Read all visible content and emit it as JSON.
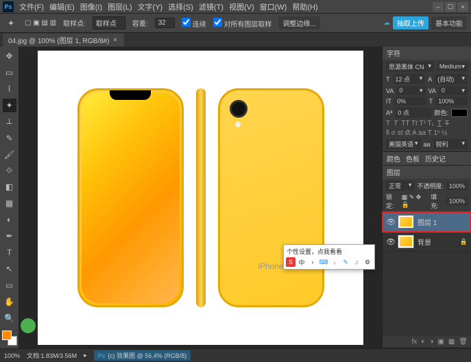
{
  "menu": [
    "文件(F)",
    "编辑(E)",
    "图像(I)",
    "图层(L)",
    "文字(Y)",
    "选择(S)",
    "滤镜(T)",
    "视图(V)",
    "窗口(W)",
    "帮助(H)"
  ],
  "options": {
    "sample_label": "取样点:",
    "sample_val": "取样点",
    "diameter_label": "容差:",
    "diameter_val": "32",
    "anti": "连续",
    "contig": "对所有图层取样",
    "refine": "调整边缘...",
    "upload": "抽取上传",
    "essentials": "基本功能"
  },
  "doc_tab": "04.jpg @ 100% (图层 1, RGB/8#)",
  "char_panel": {
    "tab": "字符",
    "font": "思源黑体 CN",
    "weight": "Medium",
    "size_label": "T",
    "size": "12 点",
    "leading_label": "A",
    "leading": "(自动)",
    "va": "VA",
    "va_val": "0",
    "tracking": "0",
    "scale_h": "0%",
    "scale_v": "",
    "baseline": "0 点",
    "color_label": "颜色:",
    "text_pct": "100%",
    "lang": "美国英语",
    "aa": "锐利"
  },
  "history_tabs": [
    "颜色",
    "色板",
    "历史记"
  ],
  "layers": {
    "tab": "图层",
    "blend": "正常",
    "opacity_label": "不透明度:",
    "opacity": "100%",
    "lock_label": "锁定:",
    "fill_label": "填充:",
    "fill": "100%",
    "items": [
      {
        "name": "图层 1",
        "selected": true,
        "locked": false
      },
      {
        "name": "背景",
        "selected": false,
        "locked": true
      }
    ]
  },
  "status": {
    "zoom": "100%",
    "docinfo": "文档:1.83M/3.56M",
    "secondary": "(c) 效果图 @ 56.4% (RGB/8)"
  },
  "ime": {
    "header": "个性设置，点我看看",
    "chars": [
      "S",
      "中",
      "›",
      "⌨",
      "↓",
      "✎",
      "♫",
      "⚙"
    ]
  },
  "phone_brand": "iPhone"
}
